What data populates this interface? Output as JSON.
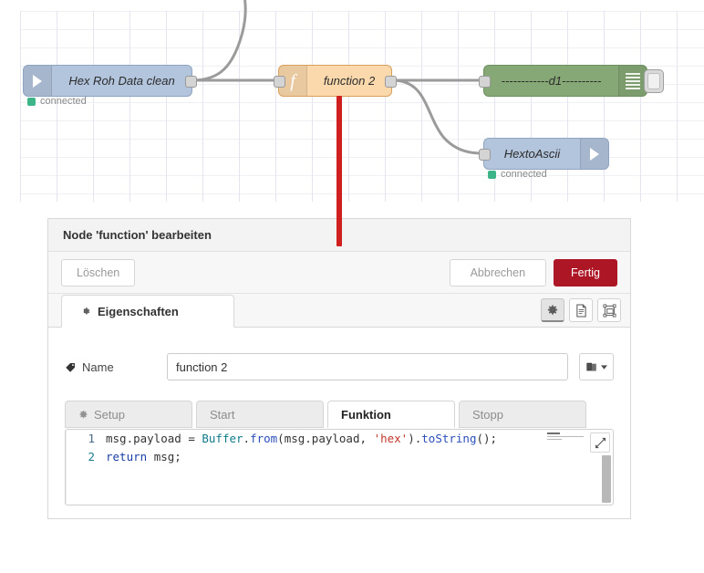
{
  "canvas": {
    "nodes": [
      {
        "id": "hex-roh-data-clean",
        "label": "Hex Roh Data clean",
        "status": "connected",
        "icon": "arrow-right-icon",
        "color": "#b3c5dd"
      },
      {
        "id": "function-2",
        "label": "function 2",
        "icon": "function-fx-icon",
        "color": "#fbd9ad"
      },
      {
        "id": "d1-debug",
        "label": "------------d1----------",
        "icon": "debug-lines-icon",
        "color": "#86a877"
      },
      {
        "id": "hextoascii",
        "label": "HextoAscii",
        "status": "connected",
        "icon": "arrow-right-icon",
        "color": "#b3c5dd"
      }
    ],
    "annotation_bar_color": "#d01f1f"
  },
  "dialog": {
    "title": "Node 'function' bearbeiten",
    "toolbar": {
      "delete_label": "Löschen",
      "cancel_label": "Abbrechen",
      "done_label": "Fertig",
      "done_color": "#ad1625"
    },
    "tab": {
      "label": "Eigenschaften",
      "icon": "gear-icon"
    },
    "tab_icons": [
      {
        "name": "gear-icon",
        "active": true
      },
      {
        "name": "document-icon",
        "active": false
      },
      {
        "name": "appearance-icon",
        "active": false
      }
    ],
    "name_field": {
      "label": "Name",
      "icon": "tag-icon",
      "value": "function 2",
      "placeholder": "Name",
      "dropdown_icon": "book-chevron-icon"
    },
    "subtabs": [
      {
        "label": "Setup",
        "icon": "gear-icon",
        "active": false
      },
      {
        "label": "Start",
        "icon": "",
        "active": false
      },
      {
        "label": "Funktion",
        "icon": "",
        "active": true
      },
      {
        "label": "Stopp",
        "icon": "",
        "active": false
      }
    ],
    "editor": {
      "lines": [
        {
          "number": "1",
          "text": "msg.payload = Buffer.from(msg.payload, 'hex').toString();"
        },
        {
          "number": "2",
          "text": "return msg;"
        }
      ],
      "expand_icon": "expand-diagonal-icon",
      "minimap_icon": "minimap-preview"
    }
  }
}
